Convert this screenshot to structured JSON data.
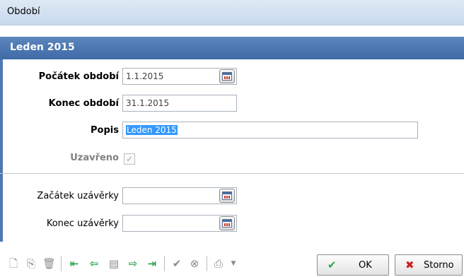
{
  "window": {
    "title": "Období"
  },
  "header": {
    "title": "Leden 2015"
  },
  "form": {
    "start_label": "Počátek období",
    "start_value": "1.1.2015",
    "end_label": "Konec období",
    "end_value": "31.1.2015",
    "desc_label": "Popis",
    "desc_value": "Leden 2015",
    "closed_label": "Uzavřeno",
    "closed_checked": true,
    "closing_start_label": "Začátek uzávěrky",
    "closing_start_value": "",
    "closing_end_label": "Konec uzávěrky",
    "closing_end_value": ""
  },
  "buttons": {
    "ok": "OK",
    "cancel": "Storno"
  },
  "icons": {
    "new": "new-document-icon",
    "copy": "copy-document-icon",
    "delete": "delete-document-icon",
    "first": "first-record-icon",
    "prev": "previous-record-icon",
    "detail": "record-detail-icon",
    "next": "next-record-icon",
    "last": "last-record-icon",
    "confirm": "confirm-icon",
    "cancel": "cancel-icon",
    "print": "print-icon"
  },
  "colors": {
    "header": "#4a74ad",
    "accent_green": "#2ea44f",
    "cancel_red": "#cc1f1f",
    "selection": "#3399ff"
  }
}
